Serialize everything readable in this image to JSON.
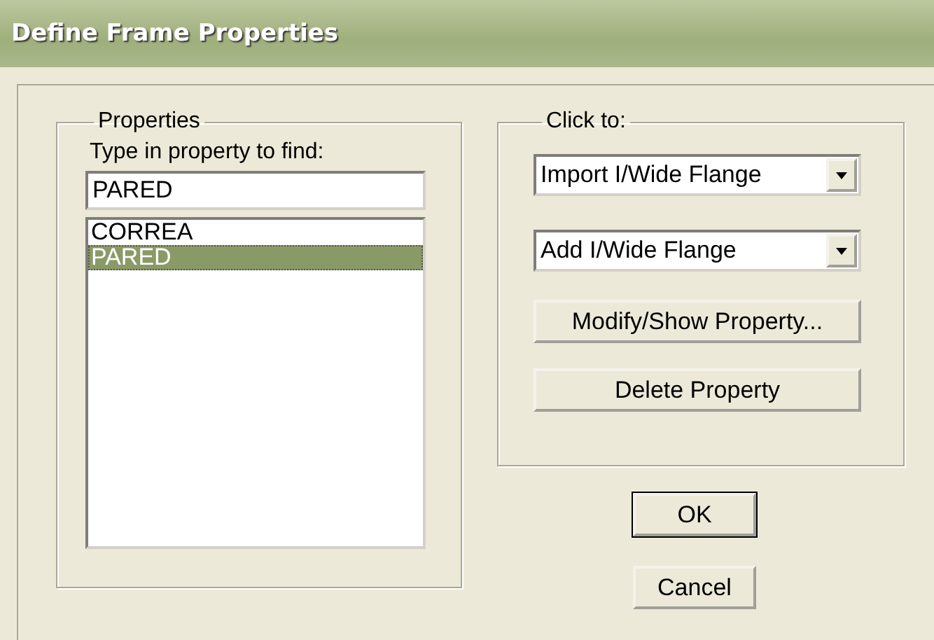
{
  "window": {
    "title": "Define Frame Properties"
  },
  "properties_group": {
    "title": "Properties",
    "search_label": "Type in property to find:",
    "search_value": "PARED",
    "items": [
      {
        "label": "CORREA",
        "selected": false
      },
      {
        "label": "PARED",
        "selected": true
      }
    ]
  },
  "click_group": {
    "title": "Click to:",
    "dropdowns": [
      {
        "value": "Import I/Wide Flange"
      },
      {
        "value": "Add I/Wide Flange"
      }
    ],
    "buttons": [
      {
        "label": "Modify/Show Property..."
      },
      {
        "label": "Delete Property"
      }
    ]
  },
  "dialog_buttons": [
    {
      "label": "OK",
      "default": true
    },
    {
      "label": "Cancel",
      "default": false
    }
  ]
}
